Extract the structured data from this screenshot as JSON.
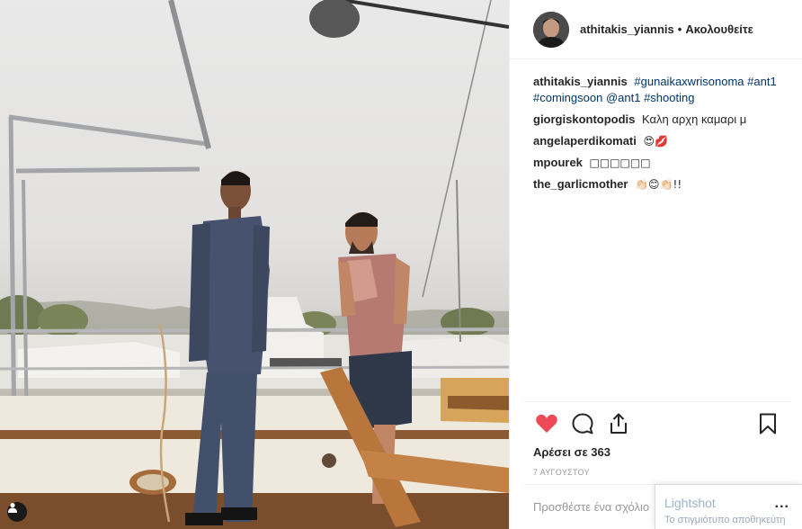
{
  "post": {
    "username": "athitakis_yiannis",
    "separator": "•",
    "follow_label": "Ακολουθείτε"
  },
  "caption": {
    "user": "athitakis_yiannis",
    "tag1": "#gunaikaxwrisonoma",
    "tag2": "#ant1",
    "tag3": "#comingsoon",
    "mention": "@ant1",
    "tag4": "#shooting"
  },
  "comments": [
    {
      "user": "giorgiskontopodis",
      "text": "Καλη αρχη καμαρι μ"
    },
    {
      "user": "angelaperdikomati",
      "text": "😍💋"
    },
    {
      "user": "mpourek",
      "text": "□□□□□□"
    },
    {
      "user": "the_garlicmother",
      "text": "👏🏻😊👏🏻!!"
    }
  ],
  "icons": {
    "like": "heart-icon",
    "comment": "comment-icon",
    "share": "share-icon",
    "save": "bookmark-icon",
    "photo_badge": "user-icon"
  },
  "colors": {
    "heart": "#ed4956",
    "link": "#003569",
    "muted": "#999999"
  },
  "likes_text": "Αρέσει σε 363",
  "date_text": "7 ΑΥΓΟΥΣΤΟΥ",
  "add_comment_placeholder": "Προσθέστε ένα σχόλιο...",
  "lightshot": {
    "title": "Lightshot",
    "subtitle": "Το στιγμιότυπο αποθηκεύτη",
    "more": "..."
  }
}
